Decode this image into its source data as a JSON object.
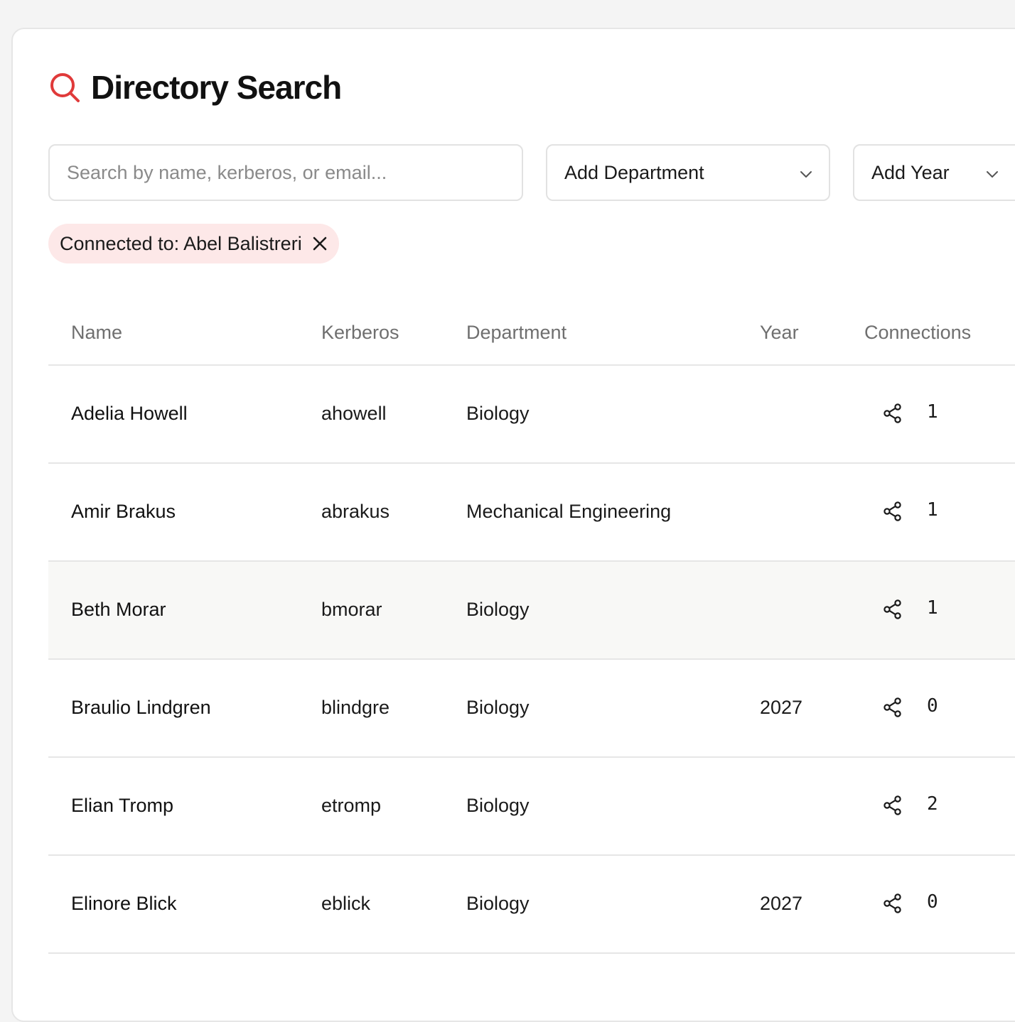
{
  "header": {
    "title": "Directory Search",
    "icon": "search-icon",
    "accent_color": "#e03a3a"
  },
  "filters": {
    "search_placeholder": "Search by name, kerberos, or email...",
    "search_value": "",
    "department_dropdown": "Add Department",
    "year_dropdown": "Add Year"
  },
  "active_filter_chip": {
    "label": "Connected to: Abel Balistreri",
    "background": "#fde8e8"
  },
  "table": {
    "columns": [
      "Name",
      "Kerberos",
      "Department",
      "Year",
      "Connections"
    ],
    "rows": [
      {
        "name": "Adelia Howell",
        "kerberos": "ahowell",
        "department": "Biology",
        "year": "",
        "connections": "1"
      },
      {
        "name": "Amir Brakus",
        "kerberos": "abrakus",
        "department": "Mechanical Engineering",
        "year": "",
        "connections": "1"
      },
      {
        "name": "Beth Morar",
        "kerberos": "bmorar",
        "department": "Biology",
        "year": "",
        "connections": "1"
      },
      {
        "name": "Braulio Lindgren",
        "kerberos": "blindgre",
        "department": "Biology",
        "year": "2027",
        "connections": "0"
      },
      {
        "name": "Elian Tromp",
        "kerberos": "etromp",
        "department": "Biology",
        "year": "",
        "connections": "2"
      },
      {
        "name": "Elinore Blick",
        "kerberos": "eblick",
        "department": "Biology",
        "year": "2027",
        "connections": "0"
      }
    ],
    "hovered_row": "Beth Morar"
  }
}
